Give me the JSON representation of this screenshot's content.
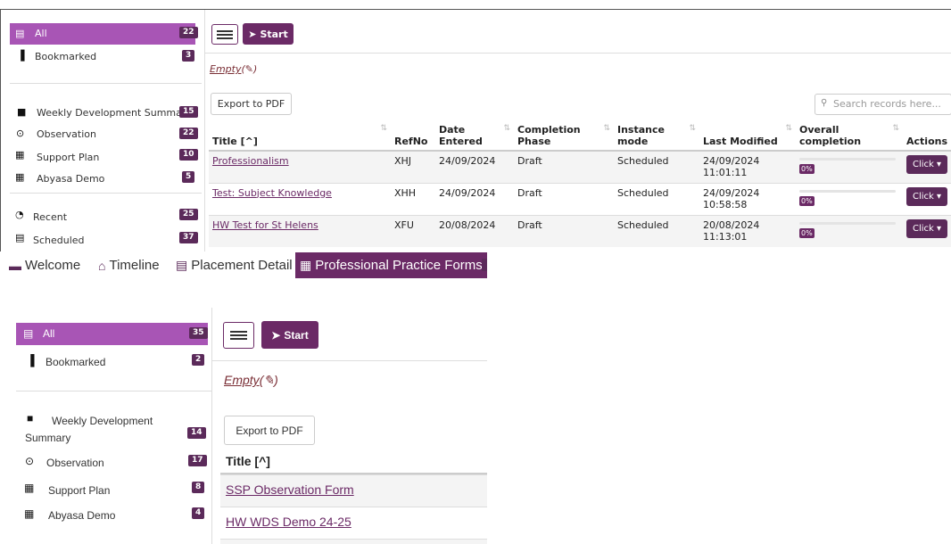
{
  "top": {
    "sidebar": {
      "items": [
        {
          "label": "All",
          "count": "22",
          "icon": "list-icon"
        },
        {
          "label": "Bookmarked",
          "count": "3",
          "icon": "bookmark-icon"
        },
        {
          "label": "Weekly Development Summary",
          "count": "15",
          "icon": "comment-icon"
        },
        {
          "label": "Observation",
          "count": "22",
          "icon": "eye-icon"
        },
        {
          "label": "Support Plan",
          "count": "10",
          "icon": "grid-icon"
        },
        {
          "label": "Abyasa Demo",
          "count": "5",
          "icon": "grid-icon"
        },
        {
          "label": "Recent",
          "count": "25",
          "icon": "clock-icon"
        },
        {
          "label": "Scheduled",
          "count": "37",
          "icon": "calendar-icon"
        }
      ]
    },
    "toolbar": {
      "start_label": "Start"
    },
    "empty_label": "Empty",
    "export_label": "Export to PDF",
    "search_placeholder": "Search records here...",
    "table": {
      "headers": [
        "Title [^]",
        "RefNo",
        "Date Entered",
        "Completion Phase",
        "Instance mode",
        "Last Modified",
        "Overall completion",
        "Actions"
      ],
      "rows": [
        {
          "title": "Professionalism",
          "ref": "XHJ",
          "date": "24/09/2024",
          "phase": "Draft",
          "mode": "Scheduled",
          "modified_date": "24/09/2024",
          "modified_time": "11:01:11",
          "completion": "0%",
          "action": "Click"
        },
        {
          "title": "Test: Subject Knowledge",
          "ref": "XHH",
          "date": "24/09/2024",
          "phase": "Draft",
          "mode": "Scheduled",
          "modified_date": "24/09/2024",
          "modified_time": "10:58:58",
          "completion": "0%",
          "action": "Click"
        },
        {
          "title": "HW Test for St Helens",
          "ref": "XFU",
          "date": "20/08/2024",
          "phase": "Draft",
          "mode": "Scheduled",
          "modified_date": "20/08/2024",
          "modified_time": "11:13:01",
          "completion": "0%",
          "action": "Click"
        }
      ]
    }
  },
  "tabs": [
    "Welcome",
    "Timeline",
    "Placement Detail",
    "Professional Practice Forms"
  ],
  "bottom": {
    "sidebar": {
      "items": [
        {
          "label": "All",
          "count": "35"
        },
        {
          "label": "Bookmarked",
          "count": "2"
        },
        {
          "label": "Weekly Development Summary",
          "count": "14"
        },
        {
          "label": "Observation",
          "count": "17"
        },
        {
          "label": "Support Plan",
          "count": "8"
        },
        {
          "label": "Abyasa Demo",
          "count": "4"
        }
      ]
    },
    "toolbar": {
      "start_label": "Start"
    },
    "empty_label": "Empty",
    "export_label": "Export to PDF",
    "table": {
      "header": "Title [^]",
      "rows": [
        "SSP Observation Form",
        "HW WDS Demo 24-25"
      ]
    }
  },
  "colors": {
    "accent": "#6b2a66",
    "sidebar_active": "#a855b5",
    "badge": "#5b2a5a",
    "empty_text": "#7a2e35"
  }
}
